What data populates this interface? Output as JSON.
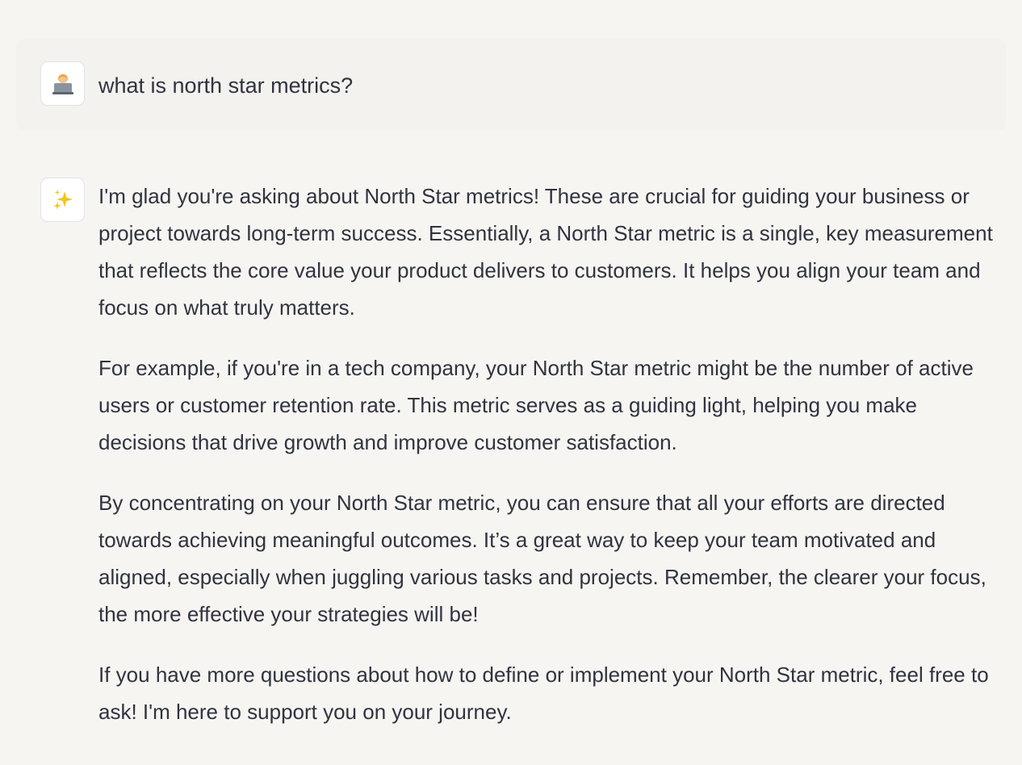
{
  "conversation": {
    "user_message": {
      "avatar_icon": "person-with-laptop-icon",
      "text": "what is north star metrics?"
    },
    "assistant_message": {
      "avatar_icon": "sparkles-icon",
      "paragraphs": [
        "I'm glad you're asking about North Star metrics! These are crucial for guiding your business or project towards long-term success. Essentially, a North Star metric is a single, key measurement that reflects the core value your product delivers to customers. It helps you align your team and focus on what truly matters.",
        "For example, if you're in a tech company, your North Star metric might be the number of active users or customer retention rate. This metric serves as a guiding light, helping you make decisions that drive growth and improve customer satisfaction.",
        "By concentrating on your North Star metric, you can ensure that all your efforts are directed towards achieving meaningful outcomes. It’s a great way to keep your team motivated and aligned, especially when juggling various tasks and projects. Remember, the clearer your focus, the more effective your strategies will be!",
        "If you have more questions about how to define or implement your North Star metric, feel free to ask! I'm here to support you on your journey."
      ]
    }
  },
  "colors": {
    "page_background": "#f6f5f2",
    "user_message_background": "#f3f2ef",
    "text": "#31333f",
    "avatar_background": "#ffffff",
    "avatar_border": "#e4e3e0",
    "sparkle": "#f5c518"
  }
}
